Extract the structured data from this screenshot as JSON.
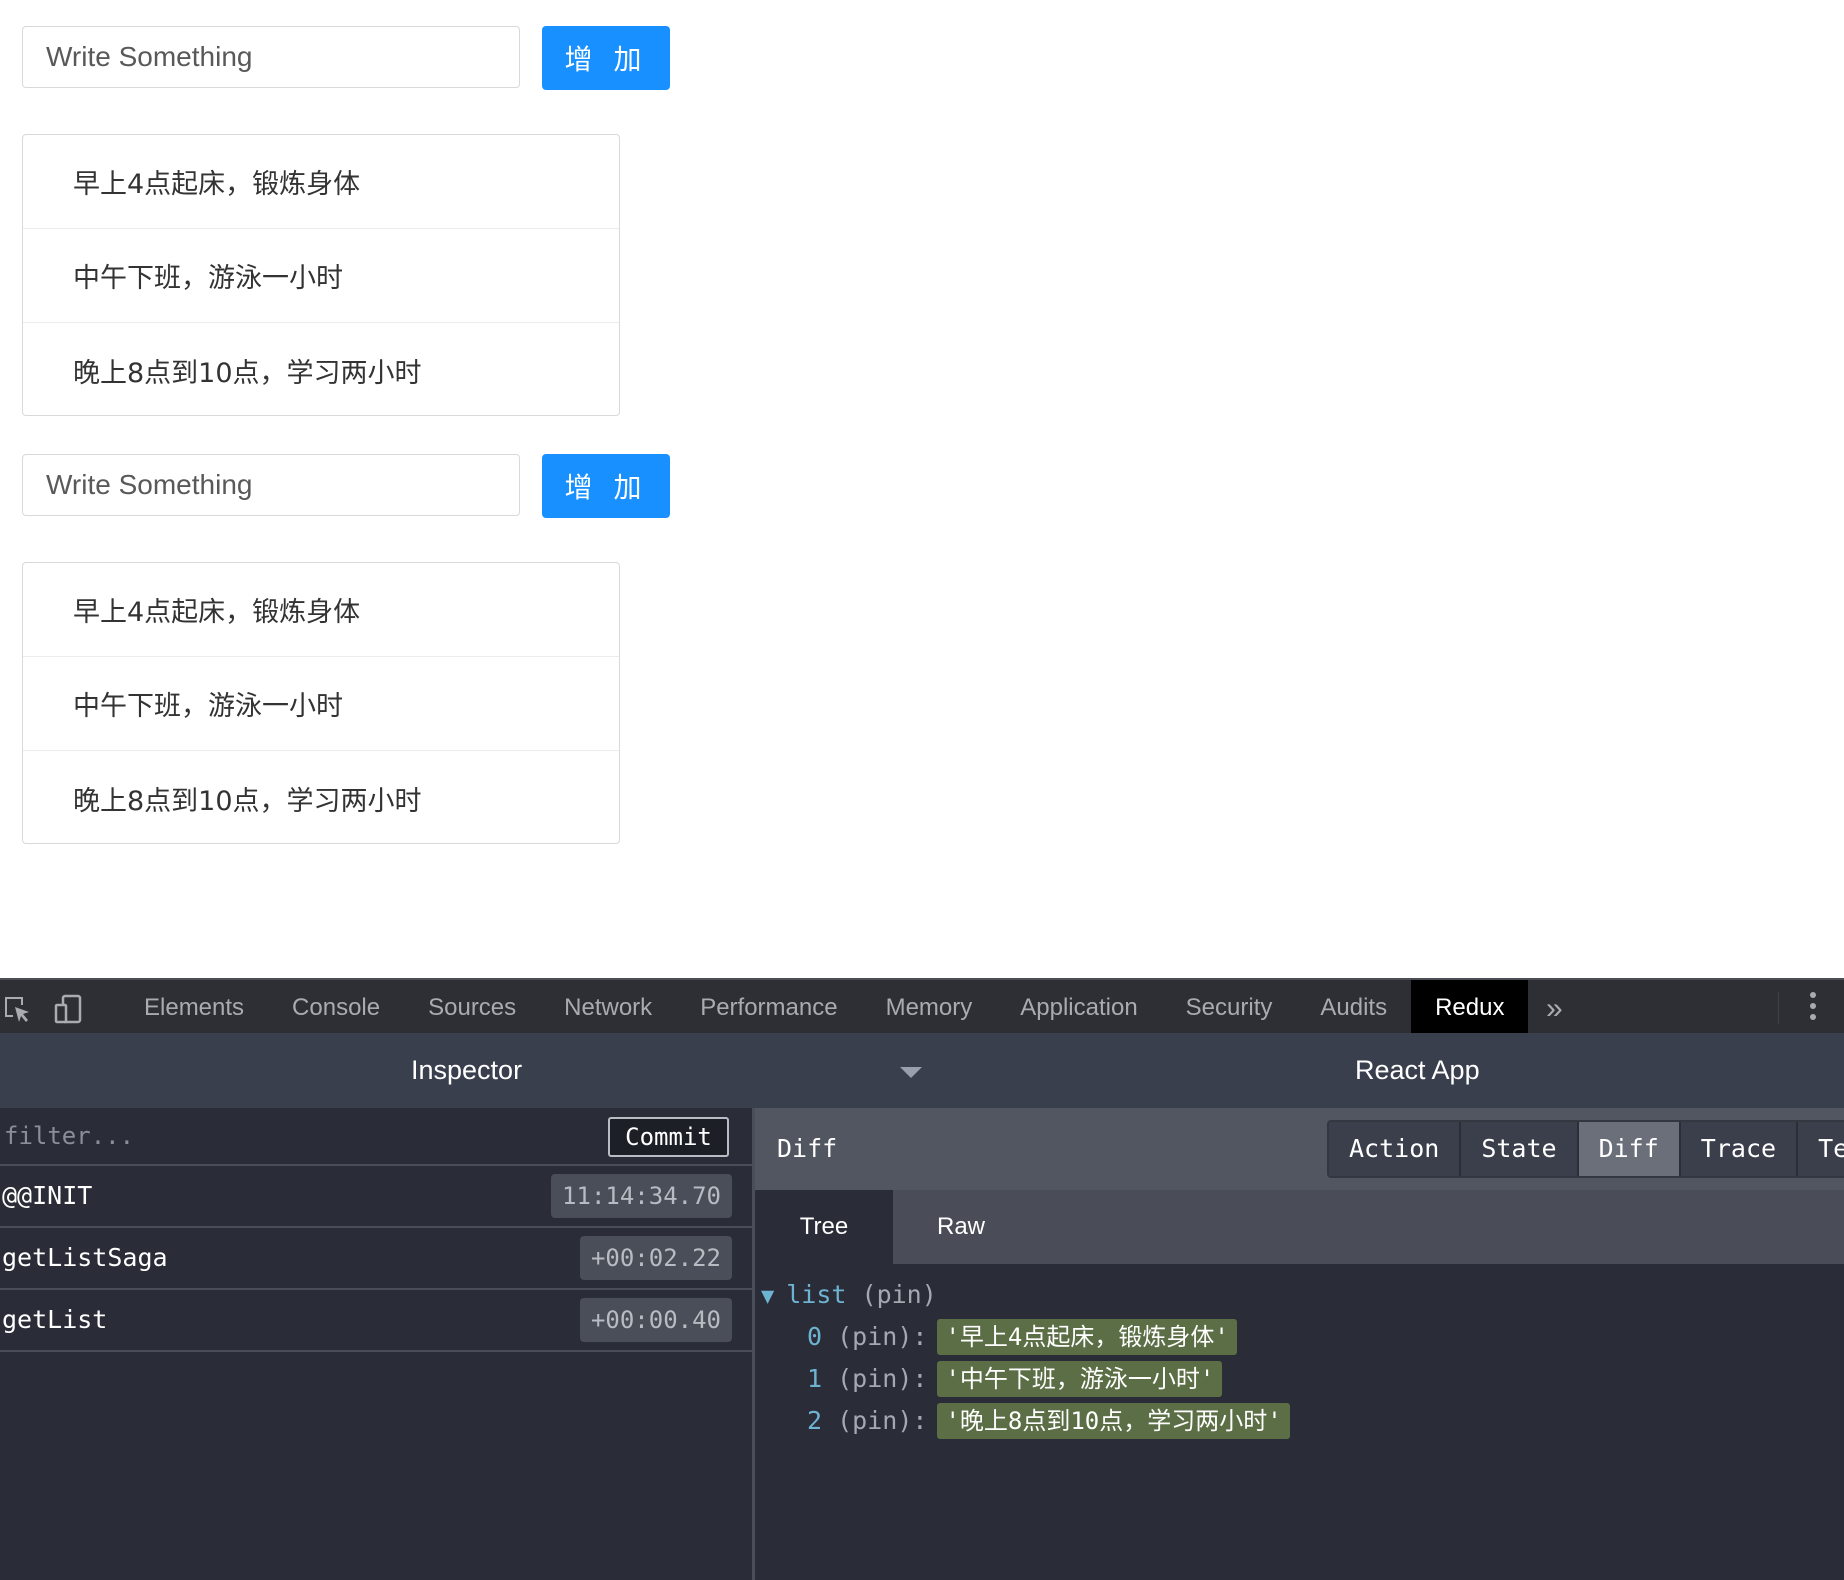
{
  "app": {
    "blocks": [
      {
        "input_placeholder": "Write Something",
        "add_label": "增 加",
        "items": [
          "早上4点起床，锻炼身体",
          "中午下班，游泳一小时",
          "晚上8点到10点，学习两小时"
        ]
      },
      {
        "input_placeholder": "Write Something",
        "add_label": "增 加",
        "items": [
          "早上4点起床，锻炼身体",
          "中午下班，游泳一小时",
          "晚上8点到10点，学习两小时"
        ]
      }
    ]
  },
  "devtools": {
    "tabs": [
      "Elements",
      "Console",
      "Sources",
      "Network",
      "Performance",
      "Memory",
      "Application",
      "Security",
      "Audits",
      "Redux"
    ],
    "active_tab": "Redux",
    "more_label": "»",
    "redux": {
      "inspector_title": "Inspector",
      "app_title": "React App",
      "filter_placeholder": "filter...",
      "commit_label": "Commit",
      "actions": [
        {
          "name": "@@INIT",
          "time": "11:14:34.70"
        },
        {
          "name": "getListSaga",
          "time": "+00:02.22"
        },
        {
          "name": "getList",
          "time": "+00:00.40"
        }
      ],
      "panel_title": "Diff",
      "view_buttons": [
        "Action",
        "State",
        "Diff",
        "Trace",
        "Tes"
      ],
      "active_view": "Diff",
      "subtabs": [
        "Tree",
        "Raw"
      ],
      "active_subtab": "Tree",
      "tree": {
        "root_key": "list",
        "root_pin": "(pin)",
        "toggle": "▼",
        "rows": [
          {
            "index": "0",
            "pin": "(pin):",
            "value": "'早上4点起床，锻炼身体'"
          },
          {
            "index": "1",
            "pin": "(pin):",
            "value": "'中午下班，游泳一小时'"
          },
          {
            "index": "2",
            "pin": "(pin):",
            "value": "'晚上8点到10点，学习两小时'"
          }
        ]
      }
    }
  },
  "colors": {
    "primary_button": "#1890ff",
    "devtools_bg": "#2a2d38",
    "diff_value_bg": "#5b6e45",
    "tree_key": "#6fb3d2"
  }
}
